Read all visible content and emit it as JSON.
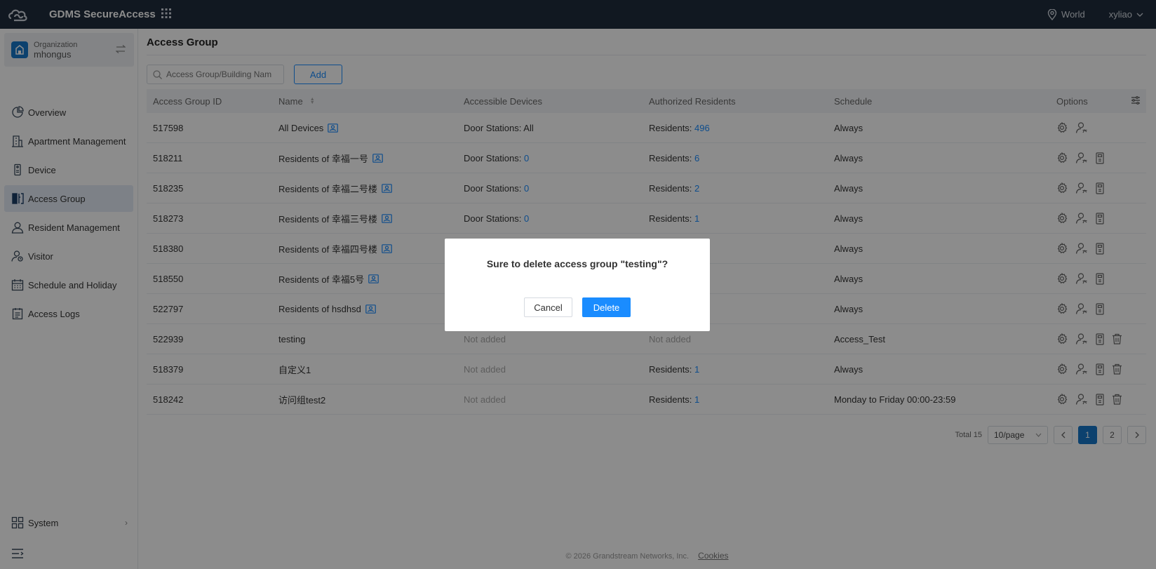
{
  "header": {
    "app_title": "GDMS SecureAccess",
    "region": "World",
    "user": "xyliao"
  },
  "sidebar": {
    "org_label": "Organization",
    "org_name": "mhongus",
    "items": [
      {
        "label": "Overview",
        "icon": "pie-chart-icon"
      },
      {
        "label": "Apartment Management",
        "icon": "building-icon"
      },
      {
        "label": "Device",
        "icon": "device-icon"
      },
      {
        "label": "Access Group",
        "icon": "access-group-icon",
        "active": true
      },
      {
        "label": "Resident Management",
        "icon": "user-icon"
      },
      {
        "label": "Visitor",
        "icon": "visitor-icon"
      },
      {
        "label": "Schedule and Holiday",
        "icon": "calendar-icon"
      },
      {
        "label": "Access Logs",
        "icon": "logs-icon"
      }
    ],
    "system_label": "System"
  },
  "main": {
    "page_title": "Access Group",
    "search_placeholder": "Access Group/Building Nam",
    "add_label": "Add",
    "columns": [
      "Access Group ID",
      "Name",
      "Accessible Devices",
      "Authorized Residents",
      "Schedule",
      "Options"
    ],
    "rows": [
      {
        "id": "517598",
        "name": "All Devices",
        "badge": true,
        "dev_label": "Door Stations: ",
        "dev_value": "All",
        "dev_link": false,
        "res_label": "Residents: ",
        "res_value": "496",
        "schedule": "Always",
        "opts": 2
      },
      {
        "id": "518211",
        "name": "Residents of 幸福一号",
        "badge": true,
        "dev_label": "Door Stations: ",
        "dev_value": "0",
        "dev_link": true,
        "res_label": "Residents: ",
        "res_value": "6",
        "schedule": "Always",
        "opts": 3
      },
      {
        "id": "518235",
        "name": "Residents of 幸福二号楼",
        "badge": true,
        "dev_label": "Door Stations: ",
        "dev_value": "0",
        "dev_link": true,
        "res_label": "Residents: ",
        "res_value": "2",
        "schedule": "Always",
        "opts": 3
      },
      {
        "id": "518273",
        "name": "Residents of 幸福三号楼",
        "badge": true,
        "dev_label": "Door Stations: ",
        "dev_value": "0",
        "dev_link": true,
        "res_label": "Residents: ",
        "res_value": "1",
        "schedule": "Always",
        "opts": 3
      },
      {
        "id": "518380",
        "name": "Residents of 幸福四号楼",
        "badge": true,
        "dev_label": "",
        "dev_value": "",
        "dev_link": false,
        "res_label": "",
        "res_value": "",
        "schedule": "Always",
        "opts": 3
      },
      {
        "id": "518550",
        "name": "Residents of 幸福5号",
        "badge": true,
        "dev_label": "",
        "dev_value": "",
        "dev_link": false,
        "res_label": "",
        "res_value": "",
        "schedule": "Always",
        "opts": 3
      },
      {
        "id": "522797",
        "name": "Residents of hsdhsd",
        "badge": true,
        "dev_label": "",
        "dev_value": "",
        "dev_link": false,
        "res_label": "",
        "res_value": "",
        "schedule": "Always",
        "opts": 3
      },
      {
        "id": "522939",
        "name": "testing",
        "badge": false,
        "dev_label": "Not added",
        "dev_value": "",
        "dev_link": false,
        "dev_muted": true,
        "res_label": "Not added",
        "res_value": "",
        "res_muted": true,
        "schedule": "Access_Test",
        "opts": 4
      },
      {
        "id": "518379",
        "name": "自定义1",
        "badge": false,
        "dev_label": "Not added",
        "dev_value": "",
        "dev_link": false,
        "dev_muted": true,
        "res_label": "Residents: ",
        "res_value": "1",
        "schedule": "Always",
        "opts": 4
      },
      {
        "id": "518242",
        "name": "访问组test2",
        "badge": false,
        "dev_label": "Not added",
        "dev_value": "",
        "dev_link": false,
        "dev_muted": true,
        "res_label": "Residents: ",
        "res_value": "1",
        "schedule": "Monday to Friday 00:00-23:59",
        "opts": 4
      }
    ],
    "pagination": {
      "total": "Total 15",
      "page_size": "10/page",
      "pages": [
        "1",
        "2"
      ],
      "current": "1"
    },
    "footer": {
      "copyright": "© 2026 Grandstream Networks, Inc.",
      "cookies": "Cookies"
    }
  },
  "dialog": {
    "message": "Sure to delete access group \"testing\"?",
    "cancel_label": "Cancel",
    "delete_label": "Delete"
  },
  "colors": {
    "topbar": "#1f2d3d",
    "accent": "#1a8cff",
    "active_nav": "#e4ecf6"
  }
}
